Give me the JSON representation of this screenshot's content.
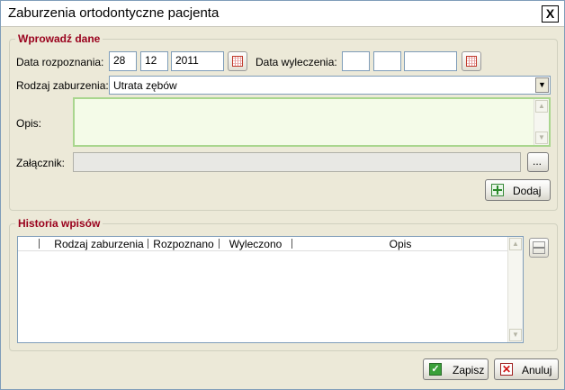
{
  "window": {
    "title": "Zaburzenia ortodontyczne pacjenta",
    "close_symbol": "X"
  },
  "entry": {
    "legend": "Wprowadź dane",
    "diagnosis_date_label": "Data rozpoznania:",
    "diagnosis_day": "28",
    "diagnosis_month": "12",
    "diagnosis_year": "2011",
    "cure_date_label": "Data wyleczenia:",
    "cure_day": "",
    "cure_month": "",
    "cure_year": "",
    "type_label": "Rodzaj zaburzenia:",
    "type_value": "Utrata zębów",
    "description_label": "Opis:",
    "description_value": "",
    "attachment_label": "Załącznik:",
    "attachment_value": "",
    "browse_label": "...",
    "add_label": "Dodaj"
  },
  "history": {
    "legend": "Historia wpisów",
    "columns": [
      "",
      "Rodzaj zaburzenia",
      "Rozpoznano",
      "Wyleczono",
      "Opis"
    ],
    "rows": []
  },
  "footer": {
    "save_label": "Zapisz",
    "cancel_label": "Anuluj"
  },
  "colors": {
    "legend": "#99001c",
    "textarea_border": "#a9d68e",
    "textarea_bg": "#f4fbe8"
  }
}
